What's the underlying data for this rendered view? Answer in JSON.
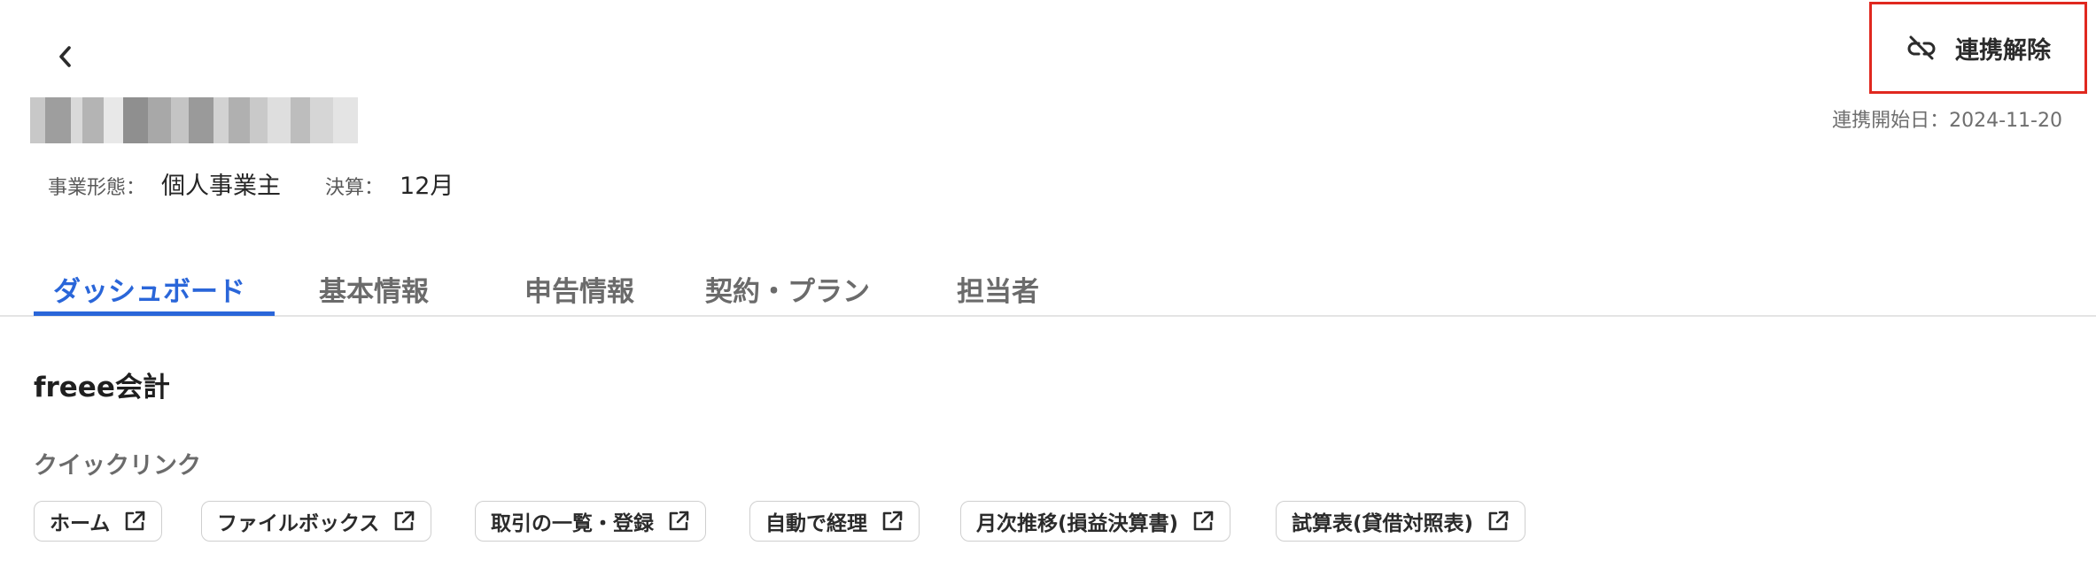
{
  "header": {
    "back_icon": "chevron-left-icon",
    "business_type_label": "事業形態：",
    "business_type_value": "個人事業主",
    "fiscal_label": "決算：",
    "fiscal_value": "12月",
    "unlink_label": "連携解除",
    "unlink_icon": "unlink-icon",
    "unlink_highlight_color": "#e0281f",
    "link_start": "連携開始日：2024-11-20"
  },
  "tabs": [
    {
      "label": "ダッシュボード",
      "active": true
    },
    {
      "label": "基本情報",
      "active": false
    },
    {
      "label": "申告情報",
      "active": false
    },
    {
      "label": "契約・プラン",
      "active": false
    },
    {
      "label": "担当者",
      "active": false
    }
  ],
  "accent_color": "#2a66d9",
  "main": {
    "section_title": "freee会計",
    "quick_links_title": "クイックリンク",
    "quick_links": [
      {
        "label": "ホーム",
        "icon": "external-link-icon"
      },
      {
        "label": "ファイルボックス",
        "icon": "external-link-icon"
      },
      {
        "label": "取引の一覧・登録",
        "icon": "external-link-icon"
      },
      {
        "label": "自動で経理",
        "icon": "external-link-icon"
      },
      {
        "label": "月次推移(損益決算書)",
        "icon": "external-link-icon"
      },
      {
        "label": "試算表(貸借対照表)",
        "icon": "external-link-icon"
      }
    ]
  }
}
